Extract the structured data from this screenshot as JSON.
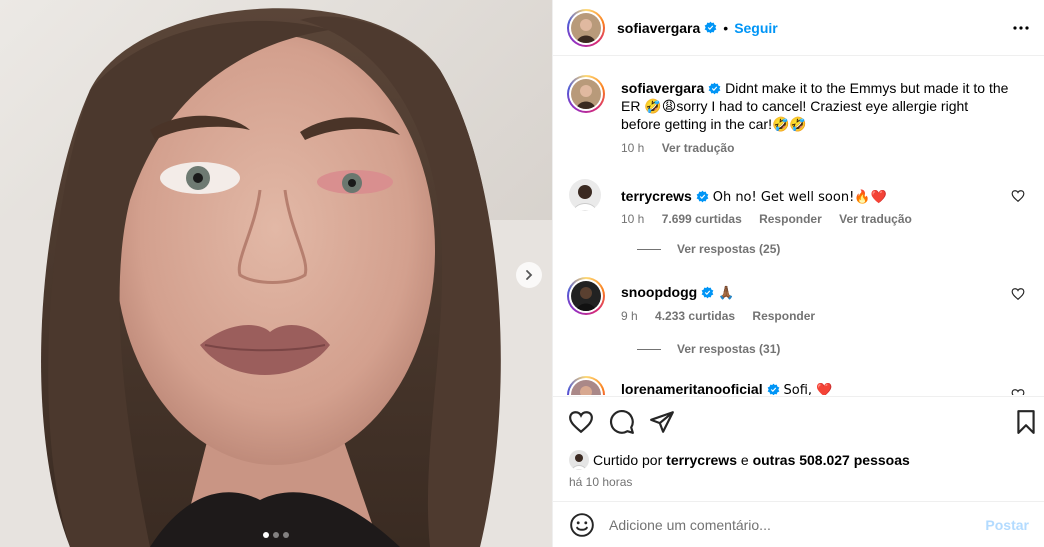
{
  "post": {
    "username": "sofiavergara",
    "follow_label": "Seguir",
    "header_separator": "•",
    "caption": "Didnt make it to the Emmys but made it to the ER 🤣😩sorry I had to cancel! Craziest eye allergie right before getting in the car!🤣🤣",
    "caption_time": "10 h",
    "caption_translate": "Ver tradução"
  },
  "comments": [
    {
      "username": "terrycrews",
      "text": "Oh no! Get well soon!🔥❤️",
      "time": "10 h",
      "likes": "7.699 curtidas",
      "reply": "Responder",
      "translate": "Ver tradução",
      "view_replies": "Ver respostas (25)"
    },
    {
      "username": "snoopdogg",
      "text": "🙏🏾",
      "time": "9 h",
      "likes": "4.233 curtidas",
      "reply": "Responder",
      "view_replies": "Ver respostas (31)"
    },
    {
      "username": "lorenameritanooficial",
      "text": "Sofi, ❤️"
    }
  ],
  "likes_bar": {
    "prefix": "Curtido por",
    "liker": "terrycrews",
    "connector": "e",
    "others": "outras 508.027 pessoas",
    "posted_time": "há 10 horas"
  },
  "composer": {
    "placeholder": "Adicione um comentário...",
    "post_label": "Postar"
  },
  "carousel": {
    "total": 3,
    "active": 1
  },
  "colors": {
    "accent": "#0095f6",
    "muted": "#737373",
    "post_disabled": "#b3dbff"
  },
  "icons": [
    "verified-icon",
    "more-options-icon",
    "heart-icon",
    "comment-icon",
    "share-icon",
    "bookmark-icon",
    "smile-icon",
    "chevron-right-icon"
  ]
}
